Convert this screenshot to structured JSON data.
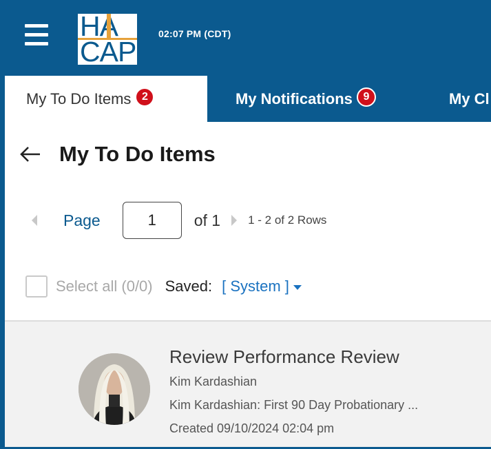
{
  "header": {
    "logo_top": "HA",
    "logo_bottom": "CAP",
    "time": "02:07 PM (CDT)",
    "brand_color": "#0b5a8f",
    "accent_color": "#e6a13a"
  },
  "tabs": [
    {
      "label": "My To Do Items",
      "badge": "2",
      "active": true
    },
    {
      "label": "My Notifications",
      "badge": "9",
      "active": false
    },
    {
      "label": "My Cl",
      "badge": "",
      "active": false
    }
  ],
  "page": {
    "title": "My To Do Items",
    "back_icon": "arrow-left-icon"
  },
  "pager": {
    "label": "Page",
    "current": "1",
    "of": "of 1",
    "rows": "1 - 2 of 2 Rows"
  },
  "selection": {
    "select_all": "Select all (0/0)",
    "saved_label": "Saved:",
    "saved_value": "[ System ]"
  },
  "items": [
    {
      "title": "Review Performance Review",
      "person": "Kim Kardashian",
      "description": "Kim Kardashian: First 90 Day Probationary ...",
      "created": "Created 09/10/2024 02:04 pm"
    }
  ],
  "badge_color": "#d0101b"
}
